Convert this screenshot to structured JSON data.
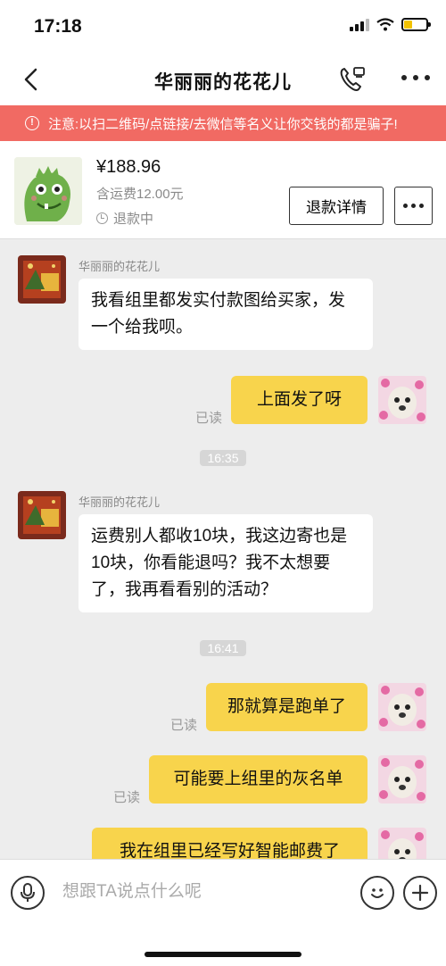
{
  "status_bar": {
    "time": "17:18"
  },
  "nav": {
    "title": "华丽丽的花花儿"
  },
  "warning": {
    "text": "注意:以扫二维码/点链接/去微信等名义让你交钱的都是骗子!"
  },
  "order": {
    "price": "¥188.96",
    "shipping": "含运费12.00元",
    "status": "退款中",
    "refund_button": "退款详情"
  },
  "messages": {
    "m1": {
      "sender": "华丽丽的花花儿",
      "text": "我看组里都发实付款图给买家，发一个给我呗。"
    },
    "m2": {
      "text": "上面发了呀",
      "read": "已读"
    },
    "t1": "16:35",
    "m3": {
      "sender": "华丽丽的花花儿",
      "text": "运费别人都收10块，我这边寄也是10块，你看能退吗？我不太想要了，我再看看别的活动？"
    },
    "t2": "16:41",
    "m4": {
      "text": "那就算是跑单了",
      "read": "已读"
    },
    "m5": {
      "text": "可能要上组里的灰名单",
      "read": "已读"
    },
    "m6": {
      "text": "我在组里已经写好智能邮费了"
    }
  },
  "input": {
    "placeholder": "想跟TA说点什么呢"
  },
  "colors": {
    "warning": "#f16a63",
    "bubble_self": "#f8d44c",
    "chat_bg": "#ededed"
  }
}
